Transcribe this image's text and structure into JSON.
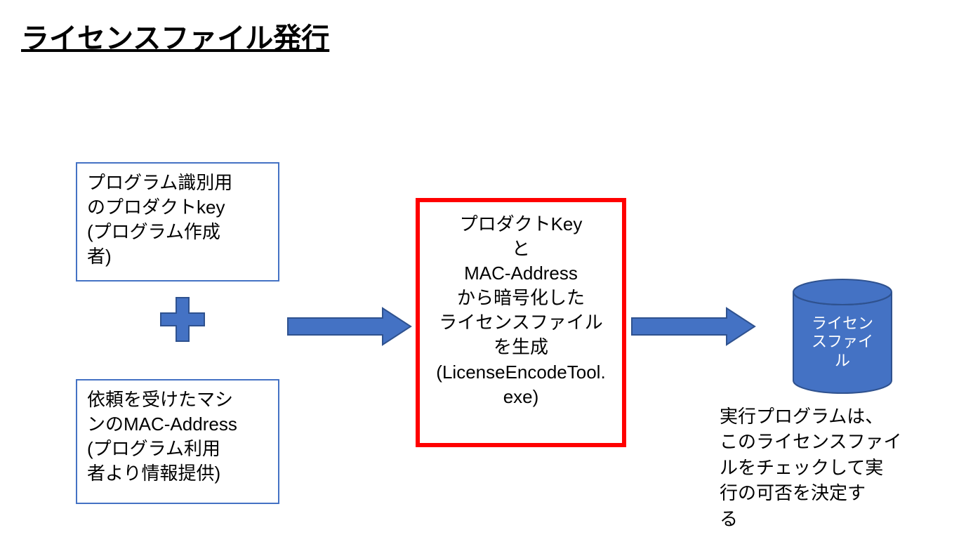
{
  "title": "ライセンスファイル発行",
  "box_top_lines": [
    "プログラム識別用",
    "のプロダクトkey",
    "(プログラム作成",
    "者)"
  ],
  "box_bottom_lines": [
    "依頼を受けたマシ",
    "ンのMAC-Address",
    "(プログラム利用",
    "者より情報提供)"
  ],
  "redbox_lines": [
    "プロダクトKey",
    "と",
    "MAC-Address",
    "から暗号化した",
    "ライセンスファイル",
    "を生成",
    "(LicenseEncodeTool.",
    "exe)"
  ],
  "cylinder_lines": [
    "ライセン",
    "スファイ",
    "ル"
  ],
  "desc_lines": [
    "実行プログラムは、",
    "このライセンスファイ",
    "ルをチェックして実",
    "行の可否を決定す",
    "る"
  ],
  "colors": {
    "shape_fill": "#4472C4",
    "shape_stroke": "#2F528F",
    "cyl_fill": "#4472C4",
    "cyl_top": "#5B8BD5"
  }
}
